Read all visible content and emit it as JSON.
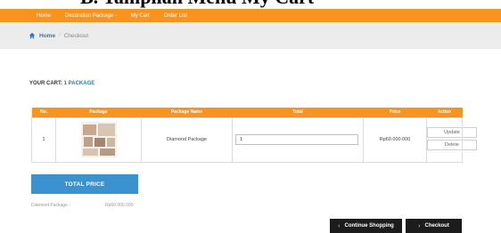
{
  "document": {
    "heading": "B.  Tampilan Menu My Cart"
  },
  "nav": {
    "items": [
      {
        "label": "Home"
      },
      {
        "label": "Decoration Package -"
      },
      {
        "label": "My Cart"
      },
      {
        "label": "Order List"
      }
    ],
    "bg_color": "#f7931e"
  },
  "breadcrumb": {
    "home": "Home",
    "separator": "/",
    "current": "Checkout"
  },
  "cart": {
    "label": "YOUR CART:",
    "count": "1 PACKAGE"
  },
  "table": {
    "headers": [
      "No.",
      "Package",
      "Package Name",
      "Total",
      "Price",
      "Action"
    ],
    "rows": [
      {
        "no": "1",
        "package_name": "Diamond Package",
        "total_value": "1",
        "price": "Rp60.000.000",
        "update_label": "Update",
        "delete_label": "Delete"
      }
    ]
  },
  "summary": {
    "total_price_label": "TOTAL PRICE",
    "item_label": "Diamond Package -",
    "item_value": "Rp60.000.000"
  },
  "actions": {
    "continue_label": "Continue Shopping",
    "checkout_label": "Checkout"
  },
  "colors": {
    "accent": "#f7931e",
    "primary": "#3a92cf",
    "dark": "#1c1c1c"
  }
}
